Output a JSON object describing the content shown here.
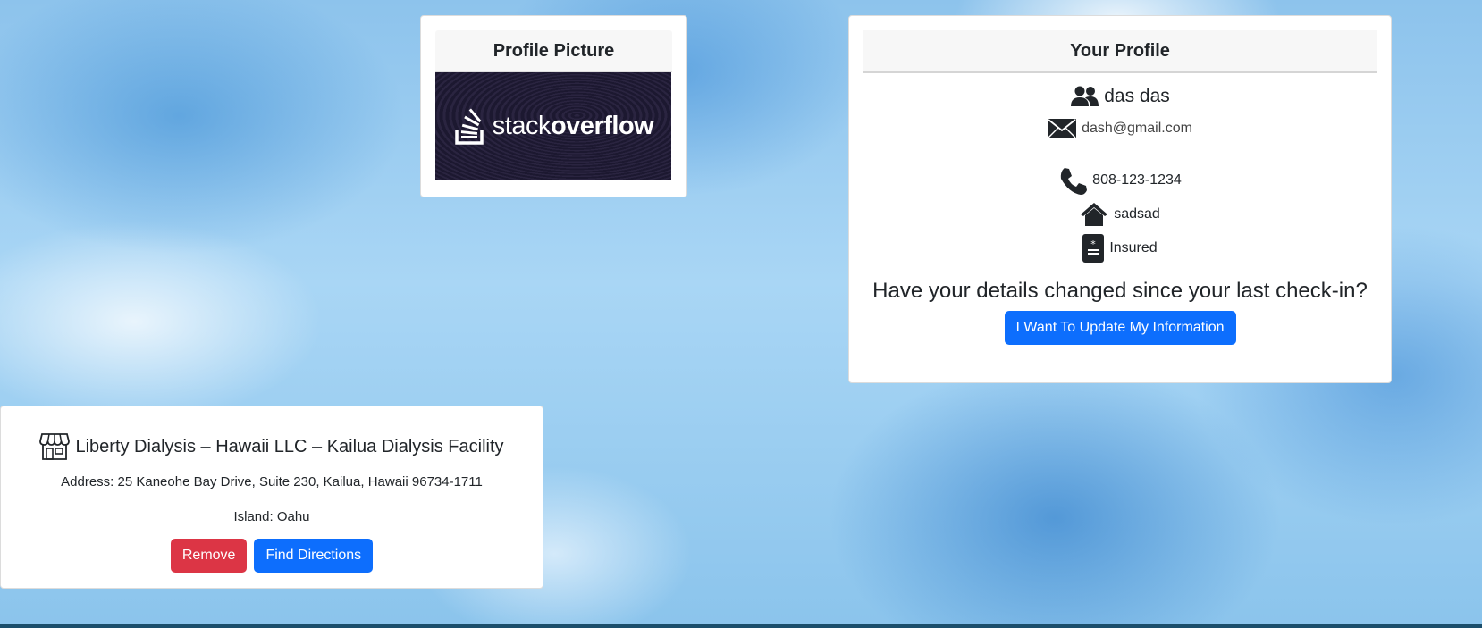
{
  "picture_card": {
    "title": "Profile Picture",
    "image": {
      "text_light": "stack",
      "text_bold": "overflow"
    }
  },
  "profile_card": {
    "title": "Your Profile",
    "name": "das das",
    "email": "dash@gmail.com",
    "phone": "808-123-1234",
    "address": "sadsad",
    "insurance": "Insured",
    "question": "Have your details changed since your last check-in?",
    "update_button": "I Want To Update My Information"
  },
  "facility_card": {
    "name": "Liberty Dialysis – Hawaii LLC – Kailua Dialysis Facility",
    "address": "Address: 25 Kaneohe Bay Drive, Suite 230, Kailua, Hawaii 96734-1711",
    "island": "Island: Oahu",
    "remove_button": "Remove",
    "directions_button": "Find Directions"
  },
  "colors": {
    "primary": "#0d6efd",
    "danger": "#dc3545",
    "background": "#a9d6f5"
  },
  "icons": [
    "users-icon",
    "envelope-icon",
    "phone-icon",
    "home-icon",
    "id-card-icon",
    "store-icon",
    "stack-overflow-logo-icon"
  ]
}
